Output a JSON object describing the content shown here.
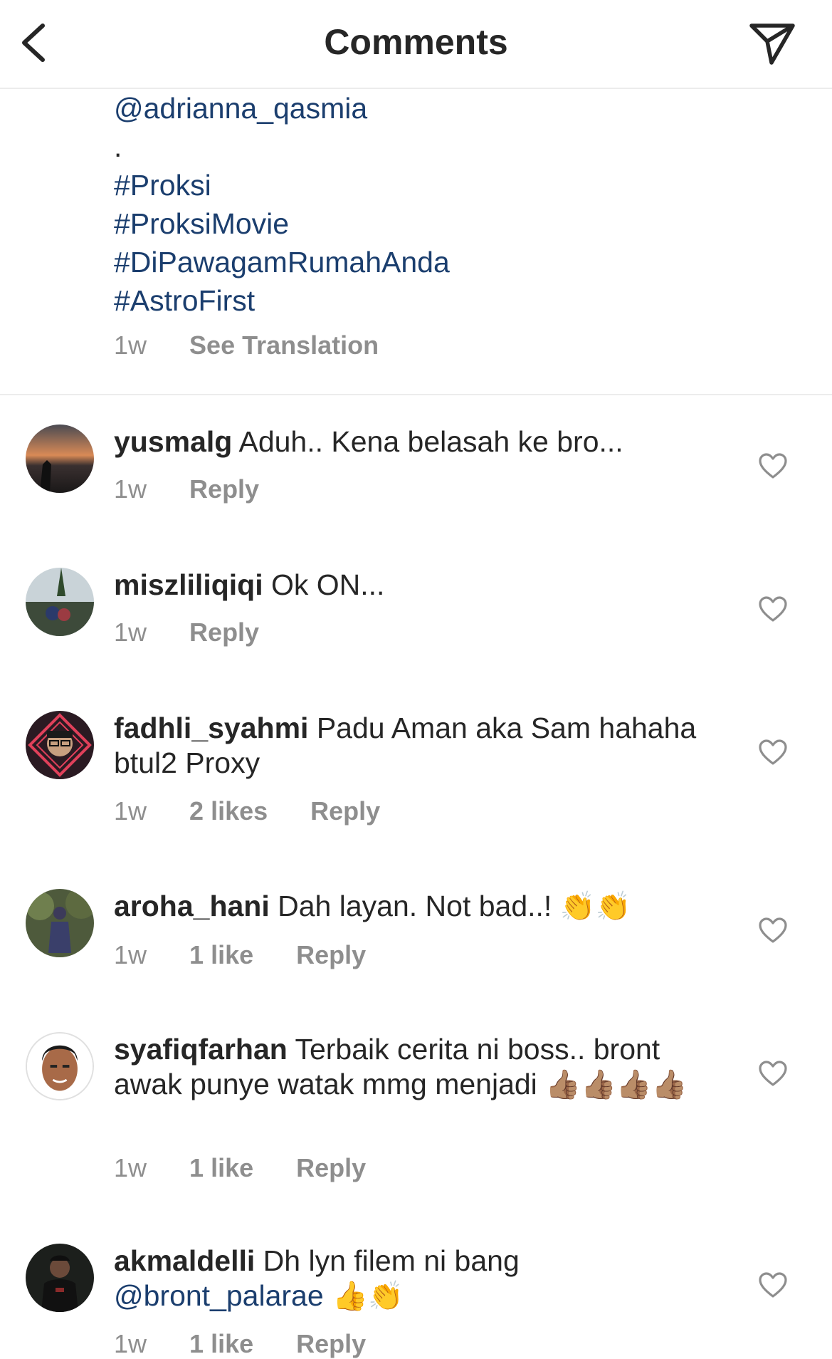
{
  "header": {
    "title": "Comments"
  },
  "caption": {
    "lines": [
      "@adrianna_qasmia",
      ".",
      "#Proksi",
      "#ProksiMovie",
      "#DiPawagamRumahAnda",
      "#AstroFirst"
    ],
    "time": "1w",
    "translation": "See Translation"
  },
  "comments": [
    {
      "user": "yusmalg",
      "text": " Aduh.. Kena belasah ke bro...",
      "time": "1w",
      "reply": "Reply"
    },
    {
      "user": "miszliliqiqi",
      "text": " Ok ON...",
      "time": "1w",
      "reply": "Reply"
    },
    {
      "user": "fadhli_syahmi",
      "text": " Padu Aman aka Sam hahaha btul2 Proxy",
      "time": "1w",
      "likes": "2 likes",
      "reply": "Reply"
    },
    {
      "user": "aroha_hani",
      "text": " Dah layan. Not bad..! ",
      "emoji": "👏👏",
      "time": "1w",
      "likes": "1 like",
      "reply": "Reply"
    },
    {
      "user": "syafiqfarhan",
      "text": " Terbaik cerita ni boss.. bront awak punye watak mmg menjadi ",
      "emoji": "👍🏽👍🏽👍🏽👍🏽",
      "time": "1w",
      "likes": "1 like",
      "reply": "Reply"
    },
    {
      "user": "akmaldelli",
      "text": " Dh lyn filem ni bang ",
      "mention": "@bront_palarae",
      "emoji": " 👍👏",
      "time": "1w",
      "likes": "1 like",
      "reply": "Reply"
    }
  ]
}
